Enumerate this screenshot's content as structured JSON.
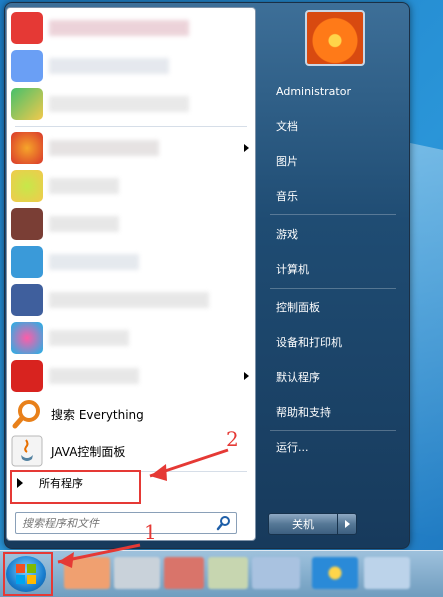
{
  "start_menu": {
    "user": {
      "name": "Administrator"
    },
    "pinned_programs": [
      {
        "label": "搜索 Everything",
        "icon": "everything-search-icon"
      },
      {
        "label": "JAVA控制面板",
        "icon": "java-icon"
      }
    ],
    "all_programs_label": "所有程序",
    "search": {
      "placeholder": "搜索程序和文件"
    },
    "right_items": [
      {
        "label": "Administrator"
      },
      {
        "label": "文档"
      },
      {
        "label": "图片"
      },
      {
        "label": "音乐"
      },
      {
        "label": "游戏"
      },
      {
        "label": "计算机"
      },
      {
        "label": "控制面板"
      },
      {
        "label": "设备和打印机"
      },
      {
        "label": "默认程序"
      },
      {
        "label": "帮助和支持"
      },
      {
        "label": "运行..."
      }
    ],
    "shutdown_label": "关机"
  },
  "annotations": {
    "step1": "1",
    "step2": "2"
  },
  "colors": {
    "accent": "#e53935",
    "menu_blue": "#1f4c73"
  }
}
